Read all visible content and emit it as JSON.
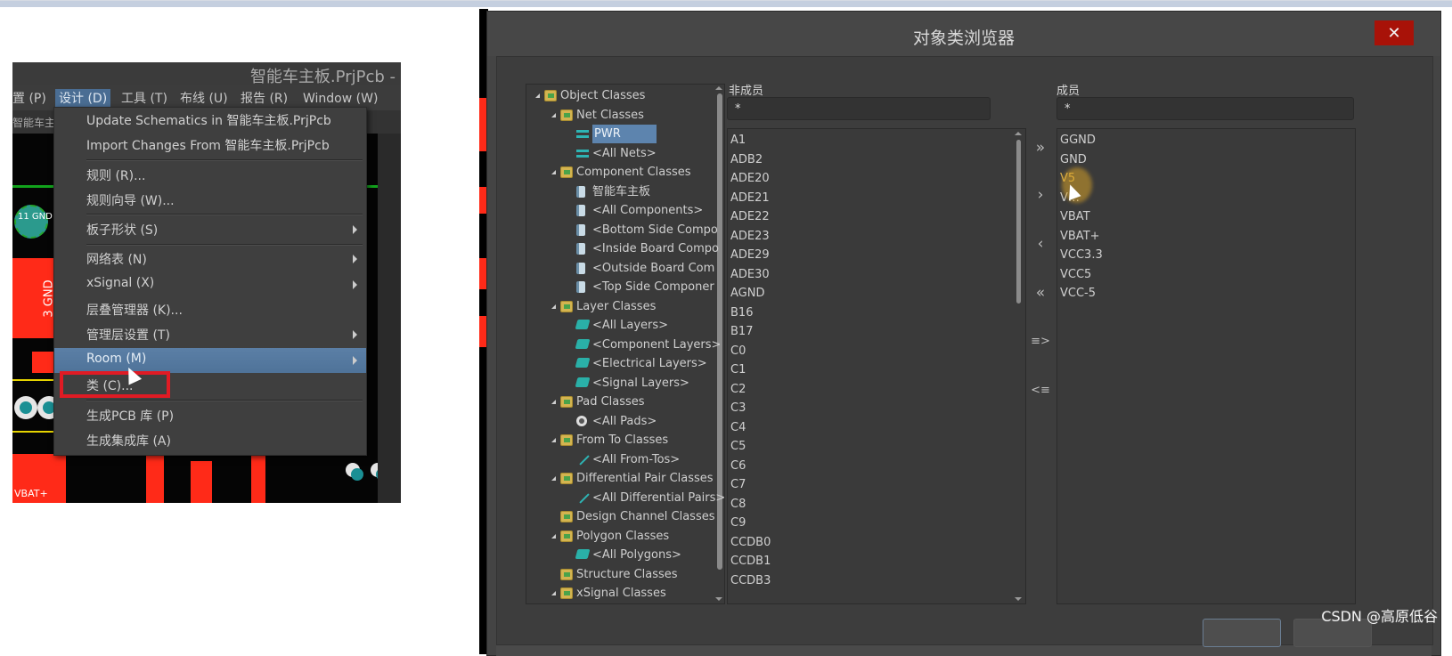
{
  "left_panel": {
    "window_title": "智能车主板.PrjPcb -",
    "menubar": [
      "置 (P)",
      "设计 (D)",
      "工具 (T)",
      "布线 (U)",
      "报告 (R)",
      "Window (W)"
    ],
    "active_menu": "设计 (D)",
    "doc_tab": "智能车主",
    "pcb_labels": {
      "pad_net": "11 GND",
      "comp_label": "3 GND",
      "bottom_label": "VBAT+"
    },
    "design_menu": {
      "items": [
        {
          "label": "Update Schematics in 智能车主板.PrjPcb",
          "submenu": false
        },
        {
          "label": "Import Changes From 智能车主板.PrjPcb",
          "submenu": false
        },
        {
          "label": "规则 (R)...",
          "submenu": false
        },
        {
          "label": "规则向导 (W)...",
          "submenu": false
        },
        {
          "label": "板子形状 (S)",
          "submenu": true
        },
        {
          "label": "网络表 (N)",
          "submenu": true
        },
        {
          "label": "xSignal (X)",
          "submenu": true
        },
        {
          "label": "层叠管理器 (K)...",
          "submenu": false
        },
        {
          "label": "管理层设置 (T)",
          "submenu": true
        },
        {
          "label": "Room (M)",
          "submenu": true,
          "highlighted": true
        },
        {
          "label": "类 (C)...",
          "submenu": false,
          "annotated": true
        },
        {
          "label": "生成PCB 库 (P)",
          "submenu": false
        },
        {
          "label": "生成集成库 (A)",
          "submenu": false
        }
      ]
    },
    "annotation_color": "#e01b24"
  },
  "dialog": {
    "title": "对象类浏览器",
    "close_icon": "close-icon",
    "tree": [
      {
        "label": "Object Classes",
        "level": 0,
        "icon": "object-classes-icon",
        "expanded": true
      },
      {
        "label": "Net Classes",
        "level": 1,
        "icon": "folder-net-icon",
        "expanded": true
      },
      {
        "label": "PWR",
        "level": 2,
        "icon": "net-icon",
        "selected": true
      },
      {
        "label": "<All Nets>",
        "level": 2,
        "icon": "net-icon"
      },
      {
        "label": "Component Classes",
        "level": 1,
        "icon": "folder-component-icon",
        "expanded": true
      },
      {
        "label": "智能车主板",
        "level": 2,
        "icon": "component-icon"
      },
      {
        "label": "<All Components>",
        "level": 2,
        "icon": "component-icon"
      },
      {
        "label": "<Bottom Side Compo",
        "level": 2,
        "icon": "component-icon"
      },
      {
        "label": "<Inside Board Compo",
        "level": 2,
        "icon": "component-icon"
      },
      {
        "label": "<Outside Board Com",
        "level": 2,
        "icon": "component-icon"
      },
      {
        "label": "<Top Side Componer",
        "level": 2,
        "icon": "component-icon"
      },
      {
        "label": "Layer Classes",
        "level": 1,
        "icon": "folder-layer-icon",
        "expanded": true
      },
      {
        "label": "<All Layers>",
        "level": 2,
        "icon": "layer-icon"
      },
      {
        "label": "<Component Layers>",
        "level": 2,
        "icon": "layer-icon"
      },
      {
        "label": "<Electrical Layers>",
        "level": 2,
        "icon": "layer-icon"
      },
      {
        "label": "<Signal Layers>",
        "level": 2,
        "icon": "layer-icon"
      },
      {
        "label": "Pad Classes",
        "level": 1,
        "icon": "folder-pad-icon",
        "expanded": true
      },
      {
        "label": "<All Pads>",
        "level": 2,
        "icon": "pad-icon"
      },
      {
        "label": "From To Classes",
        "level": 1,
        "icon": "folder-fromto-icon",
        "expanded": true
      },
      {
        "label": "<All From-Tos>",
        "level": 2,
        "icon": "fromto-icon"
      },
      {
        "label": "Differential Pair Classes",
        "level": 1,
        "icon": "folder-diffpair-icon",
        "expanded": true
      },
      {
        "label": "<All Differential Pairs>",
        "level": 2,
        "icon": "fromto-icon"
      },
      {
        "label": "Design Channel Classes",
        "level": 1,
        "icon": "folder-channel-icon",
        "expanded": false,
        "leaf": true
      },
      {
        "label": "Polygon Classes",
        "level": 1,
        "icon": "folder-polygon-icon",
        "expanded": true
      },
      {
        "label": "<All Polygons>",
        "level": 2,
        "icon": "layer-icon"
      },
      {
        "label": "Structure Classes",
        "level": 1,
        "icon": "folder-structure-icon",
        "expanded": false,
        "leaf": true
      },
      {
        "label": "xSignal Classes",
        "level": 1,
        "icon": "folder-xsignal-icon",
        "expanded": true
      }
    ],
    "non_members": {
      "label": "非成员",
      "filter": "*",
      "items": [
        "A1",
        "ADB2",
        "ADE20",
        "ADE21",
        "ADE22",
        "ADE23",
        "ADE29",
        "ADE30",
        "AGND",
        "B16",
        "B17",
        "C0",
        "C1",
        "C2",
        "C3",
        "C4",
        "C5",
        "C6",
        "C7",
        "C8",
        "C9",
        "CCDB0",
        "CCDB1",
        "CCDB3"
      ]
    },
    "members": {
      "label": "成员",
      "filter": "*",
      "items": [
        "GGND",
        "GND",
        "V5",
        "V…",
        "VBAT",
        "VBAT+",
        "VCC3.3",
        "VCC5",
        "VCC-5"
      ]
    },
    "transfer_buttons": [
      {
        "name": "add-all",
        "glyph": "»"
      },
      {
        "name": "add-selected",
        "glyph": "›"
      },
      {
        "name": "remove-selected",
        "glyph": "‹"
      },
      {
        "name": "remove-all",
        "glyph": "«"
      },
      {
        "name": "move-right",
        "glyph": "≡>"
      },
      {
        "name": "move-left",
        "glyph": "<≡"
      }
    ]
  },
  "watermark": "CSDN @高原低谷"
}
